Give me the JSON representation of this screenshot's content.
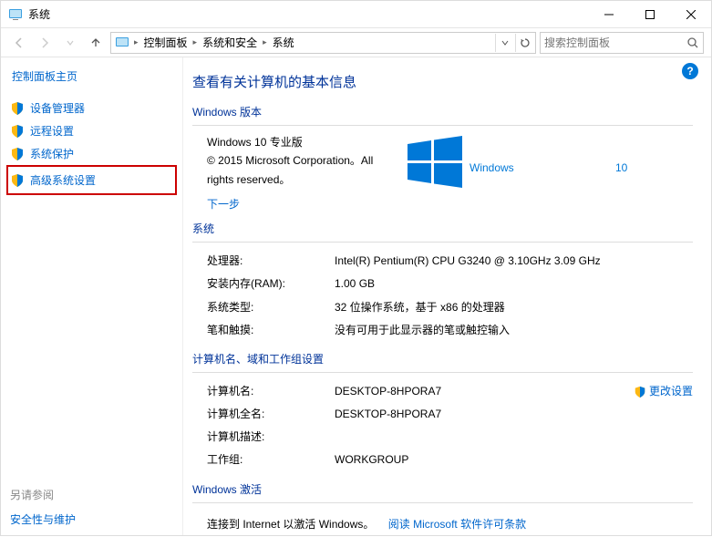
{
  "title": "系统",
  "breadcrumb": {
    "items": [
      "控制面板",
      "系统和安全",
      "系统"
    ]
  },
  "search": {
    "placeholder": "搜索控制面板"
  },
  "sidebar": {
    "home": "控制面板主页",
    "items": [
      {
        "label": "设备管理器"
      },
      {
        "label": "远程设置"
      },
      {
        "label": "系统保护"
      },
      {
        "label": "高级系统设置"
      }
    ],
    "seeAlsoTitle": "另请参阅",
    "seeAlso": [
      {
        "label": "安全性与维护"
      }
    ]
  },
  "main": {
    "heading": "查看有关计算机的基本信息",
    "editionTitle": "Windows 版本",
    "edition": {
      "name": "Windows 10 专业版",
      "copyright": "© 2015 Microsoft Corporation。All rights reserved。",
      "logoText": "Windows10"
    },
    "nextStep": "下一步",
    "systemTitle": "系统",
    "system": {
      "cpuLabel": "处理器:",
      "cpu": "Intel(R) Pentium(R) CPU G3240 @ 3.10GHz   3.09 GHz",
      "ramLabel": "安装内存(RAM):",
      "ram": "1.00 GB",
      "typeLabel": "系统类型:",
      "type": "32 位操作系统，基于 x86 的处理器",
      "penLabel": "笔和触摸:",
      "pen": "没有可用于此显示器的笔或触控输入"
    },
    "nameTitle": "计算机名、域和工作组设置",
    "name": {
      "nameLabel": "计算机名:",
      "name": "DESKTOP-8HPORA7",
      "changeLabel": "更改设置",
      "fullLabel": "计算机全名:",
      "full": "DESKTOP-8HPORA7",
      "descLabel": "计算机描述:",
      "desc": "",
      "wgLabel": "工作组:",
      "wg": "WORKGROUP"
    },
    "activationTitle": "Windows 激活",
    "activation": {
      "text": "连接到 Internet 以激活 Windows。",
      "link": "阅读 Microsoft 软件许可条款"
    }
  }
}
